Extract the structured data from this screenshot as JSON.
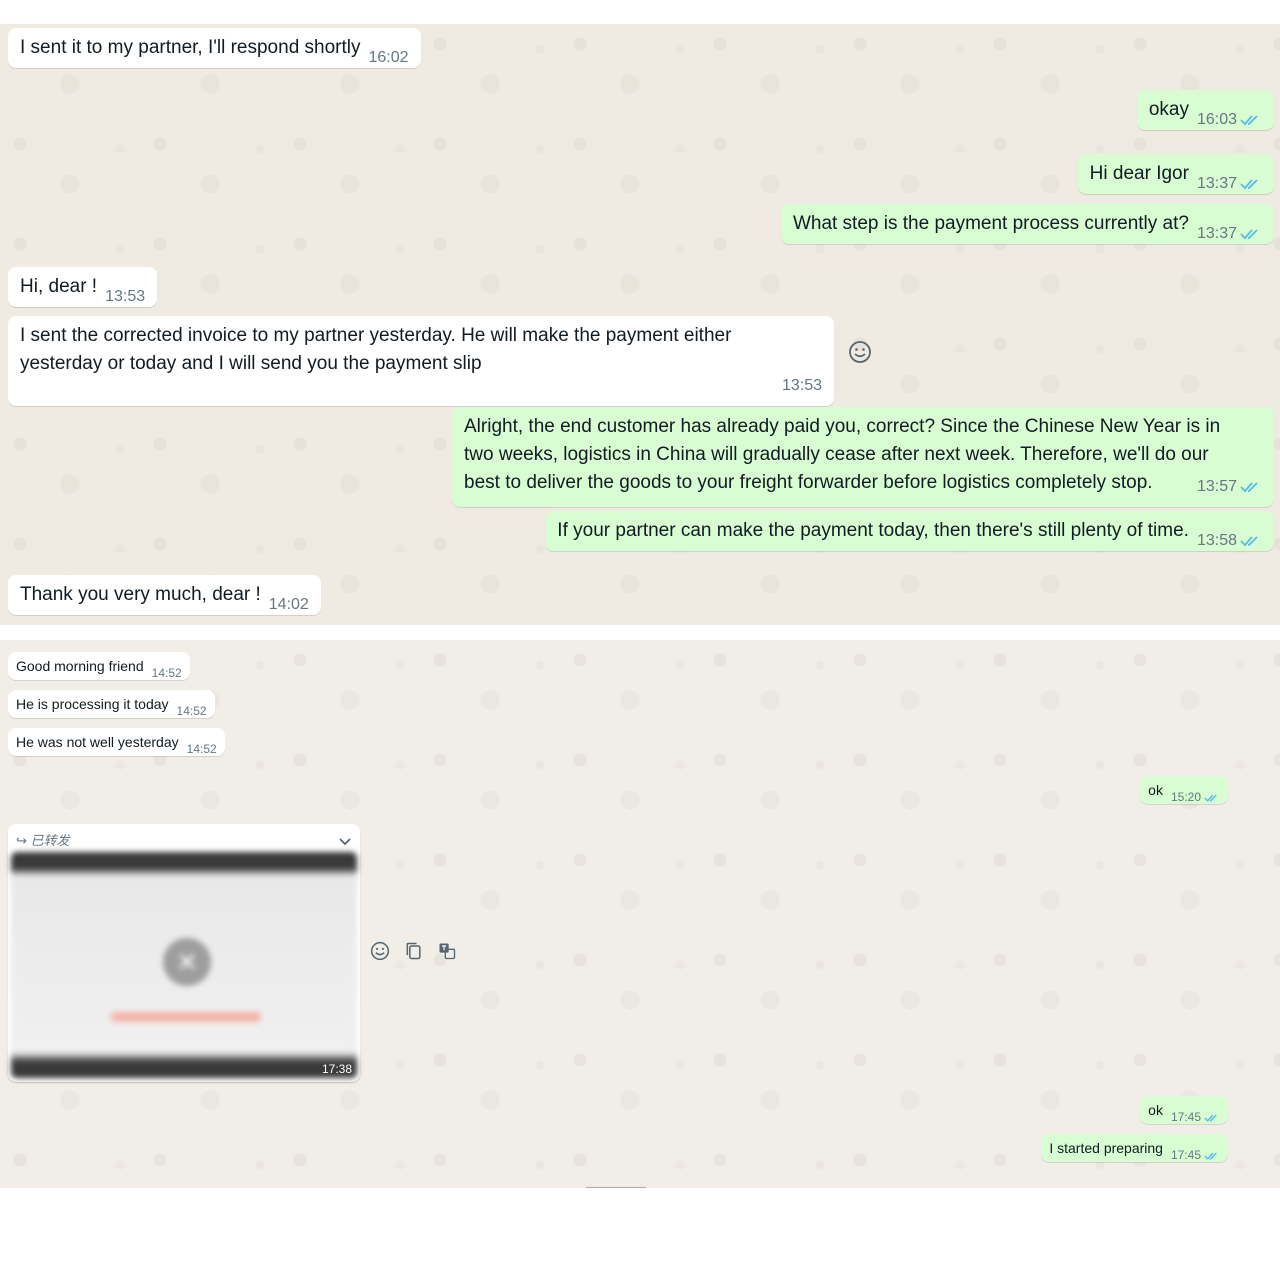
{
  "tick_color": "#53bdeb",
  "incoming_bubble_color": "#ffffff",
  "outgoing_bubble_color": "#d9fdd3",
  "panel1": {
    "messages": [
      {
        "dir": "in",
        "text": "I sent it to my partner, I'll respond shortly",
        "time": "16:02"
      },
      {
        "dir": "out",
        "text": "okay",
        "time": "16:03",
        "ticks": "read"
      },
      {
        "dir": "out",
        "text": "Hi dear Igor",
        "time": "13:37",
        "ticks": "read"
      },
      {
        "dir": "out",
        "text": "What step is the payment process currently at?",
        "time": "13:37",
        "ticks": "read"
      },
      {
        "dir": "in",
        "text": "Hi, dear !",
        "time": "13:53"
      },
      {
        "dir": "in",
        "lines": [
          "I sent the corrected invoice to my partner yesterday. He will make the payment either",
          "yesterday or today and I will send you the payment slip"
        ],
        "time": "13:53"
      },
      {
        "dir": "out",
        "lines": [
          "Alright, the end customer has already paid you, correct? Since the Chinese New Year is in",
          "two weeks, logistics in China will gradually cease after next week. Therefore, we'll do our",
          "best to deliver the goods to your freight forwarder before logistics completely stop."
        ],
        "time": "13:57",
        "ticks": "read"
      },
      {
        "dir": "out",
        "text": "If your partner can make the payment today, then there's still plenty of time.",
        "time": "13:58",
        "ticks": "read"
      },
      {
        "dir": "in",
        "text": "Thank you very much, dear !",
        "time": "14:02"
      }
    ],
    "reaction_icon": "emoji-smile-icon"
  },
  "panel2": {
    "messages": [
      {
        "dir": "in",
        "text": "Good morning friend",
        "time": "14:52"
      },
      {
        "dir": "in",
        "text": "He is processing it today",
        "time": "14:52"
      },
      {
        "dir": "in",
        "text": "He was not well yesterday",
        "time": "14:52"
      },
      {
        "dir": "out",
        "text": "ok",
        "time": "15:20",
        "ticks": "read"
      },
      {
        "dir": "out",
        "text": "ok",
        "time": "17:45",
        "ticks": "read"
      },
      {
        "dir": "out",
        "text": "I started preparing",
        "time": "17:45",
        "ticks": "read"
      }
    ],
    "forwarded_media": {
      "forwarded_label": "已转发",
      "time": "17:38",
      "icons": [
        "forward-arrow-icon",
        "chevron-down-icon",
        "close-icon"
      ]
    },
    "media_tools": [
      "emoji-smile-icon",
      "copy-icon",
      "translate-icon"
    ]
  },
  "cutoff_text": "——————"
}
